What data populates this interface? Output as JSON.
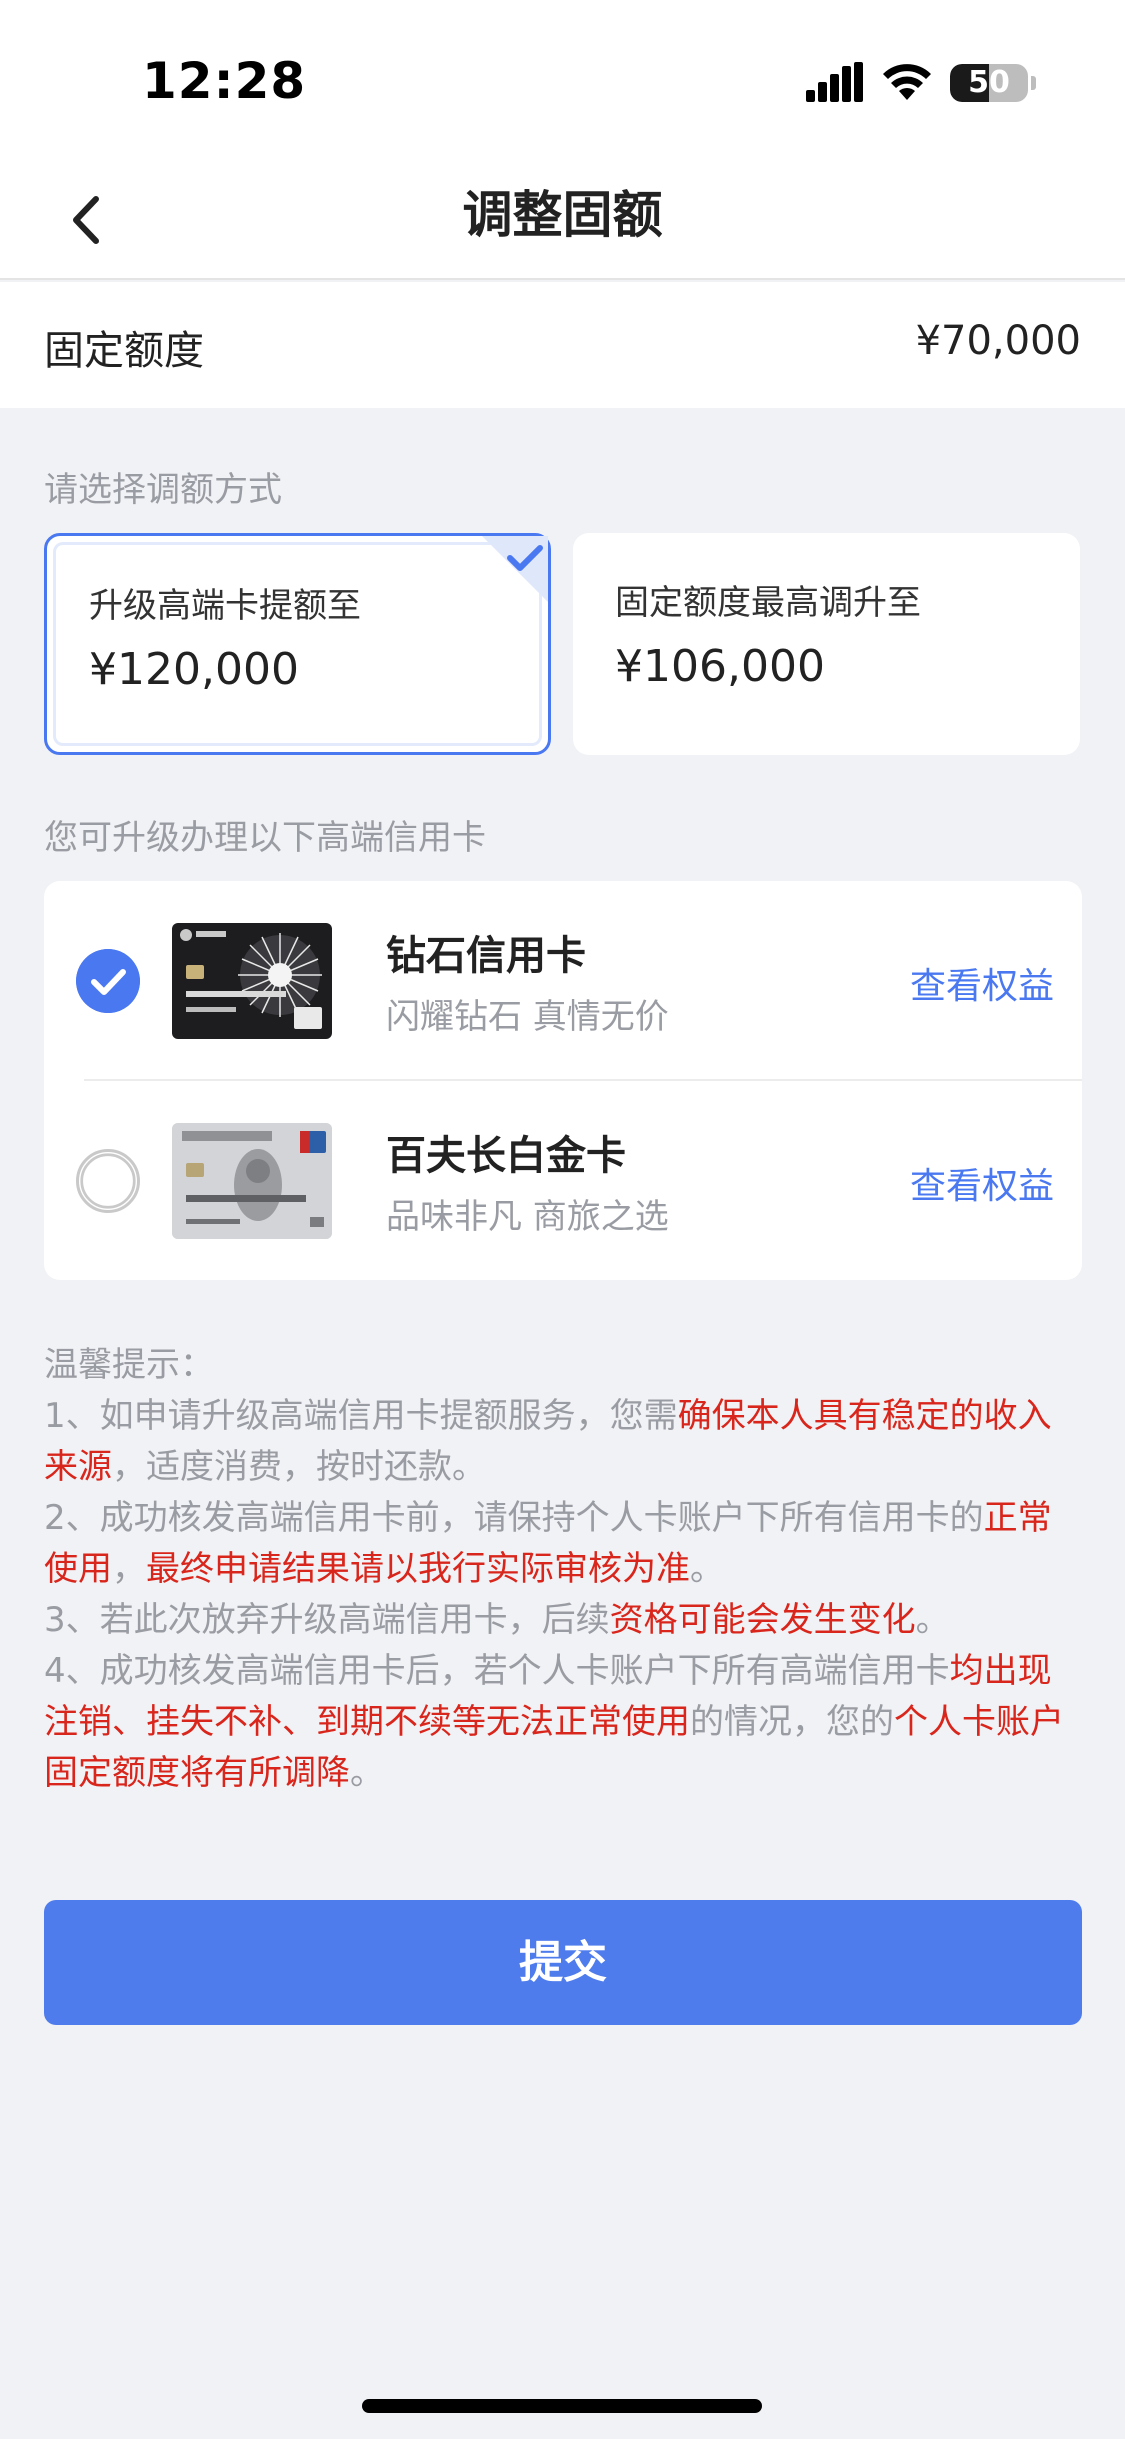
{
  "status_bar": {
    "time": "12:28",
    "battery_level": "50",
    "icons": [
      "signal-icon",
      "wifi-icon",
      "battery-icon"
    ]
  },
  "nav": {
    "title": "调整固额",
    "back_icon": "chevron-left-icon"
  },
  "fixed_limit": {
    "label": "固定额度",
    "value": "¥70,000"
  },
  "method_section": {
    "label": "请选择调额方式",
    "options": [
      {
        "label": "升级高端卡提额至",
        "amount": "¥120,000",
        "selected": true
      },
      {
        "label": "固定额度最高调升至",
        "amount": "¥106,000",
        "selected": false
      }
    ]
  },
  "cards_section": {
    "label": "您可升级办理以下高端信用卡",
    "cards": [
      {
        "name": "钻石信用卡",
        "desc": "闪耀钻石 真情无价",
        "link": "查看权益",
        "selected": true,
        "image_icon": "diamond-card-image"
      },
      {
        "name": "百夫长白金卡",
        "desc": "品味非凡 商旅之选",
        "link": "查看权益",
        "selected": false,
        "image_icon": "centurion-platinum-card-image"
      }
    ]
  },
  "tips": {
    "title": "温馨提示：",
    "items": [
      [
        {
          "text": "1、如申请升级高端信用卡提额服务，您需",
          "red": false
        },
        {
          "text": "确保本人具有稳定的收入来源",
          "red": true
        },
        {
          "text": "，适度消费，按时还款。",
          "red": false
        }
      ],
      [
        {
          "text": "2、成功核发高端信用卡前，请保持个人卡账户下所有信用卡的",
          "red": false
        },
        {
          "text": "正常使用",
          "red": true
        },
        {
          "text": "，",
          "red": false
        },
        {
          "text": "最终申请结果请以我行实际审核为准",
          "red": true
        },
        {
          "text": "。",
          "red": false
        }
      ],
      [
        {
          "text": "3、若此次放弃升级高端信用卡，后续",
          "red": false
        },
        {
          "text": "资格可能会发生变化",
          "red": true
        },
        {
          "text": "。",
          "red": false
        }
      ],
      [
        {
          "text": "4、成功核发高端信用卡后，若个人卡账户下所有高端信用卡",
          "red": false
        },
        {
          "text": "均出现注销、挂失不补、到期不续等无法正常使用",
          "red": true
        },
        {
          "text": "的情况，您的",
          "red": false
        },
        {
          "text": "个人卡账户固定额度将有所调降",
          "red": true
        },
        {
          "text": "。",
          "red": false
        }
      ]
    ]
  },
  "submit": {
    "label": "提交"
  },
  "colors": {
    "accent": "#4e7ced",
    "warning_red": "#d9261c",
    "muted_text": "#9a9ca3",
    "background": "#f1f2f5"
  }
}
